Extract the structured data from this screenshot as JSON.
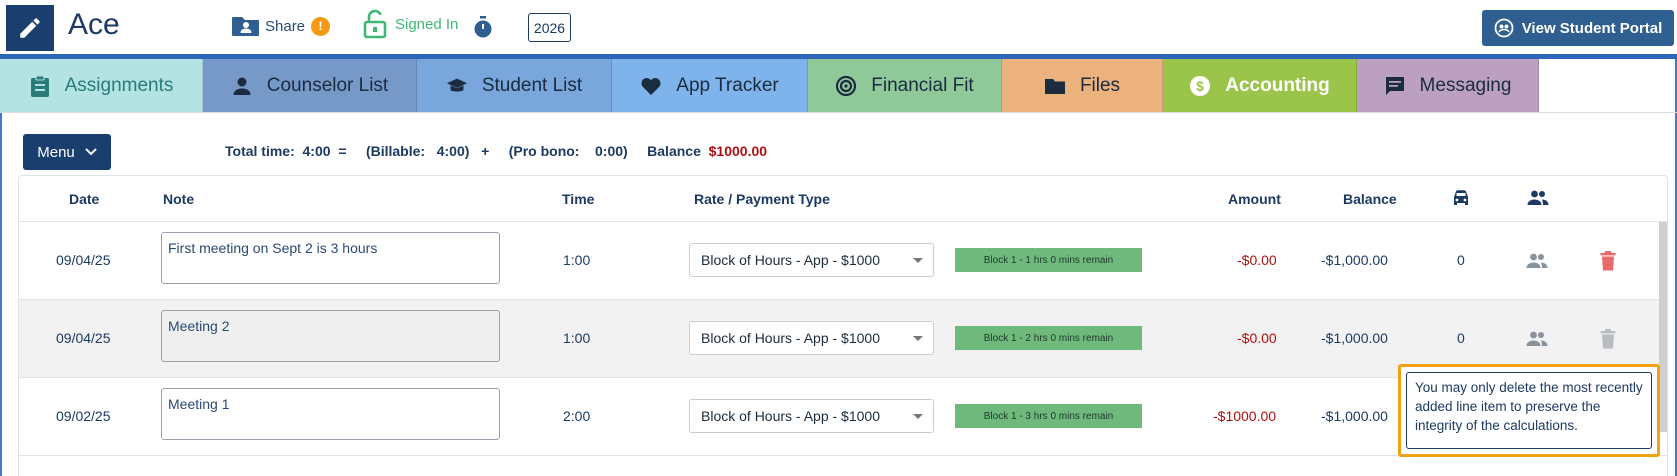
{
  "header": {
    "app_name": "Ace",
    "share_label": "Share",
    "share_badge": "!",
    "signed_in_label": "Signed In",
    "year": "2026",
    "portal_button": "View Student Portal"
  },
  "tabs": [
    {
      "label": "Assignments",
      "icon": "clipboard-icon",
      "bg": "#b3e3e3",
      "color": "#2a7a7a"
    },
    {
      "label": "Counselor List",
      "icon": "person-icon",
      "bg": "#7699c8"
    },
    {
      "label": "Student List",
      "icon": "graduation-cap-icon",
      "bg": "#79a6db"
    },
    {
      "label": "App Tracker",
      "icon": "heart-icon",
      "bg": "#7eb3eb"
    },
    {
      "label": "Financial Fit",
      "icon": "target-icon",
      "bg": "#8fc99a"
    },
    {
      "label": "Files",
      "icon": "folder-icon",
      "bg": "#ebb27e"
    },
    {
      "label": "Accounting",
      "icon": "dollar-icon",
      "bg": "#9bc44a",
      "color": "#ffffff"
    },
    {
      "label": "Messaging",
      "icon": "chat-icon",
      "bg": "#bca0c0"
    }
  ],
  "toolbar": {
    "menu_label": "Menu",
    "totals_text": "Total time:  4:00  =     (Billable:   4:00)   +     (Pro bono:    0:00)     Balance  ",
    "balance_value": "$1000.00"
  },
  "table": {
    "columns": {
      "date": "Date",
      "note": "Note",
      "time": "Time",
      "rate": "Rate / Payment Type",
      "amount": "Amount",
      "balance": "Balance"
    },
    "rows": [
      {
        "date": "09/04/25",
        "note": "First meeting on Sept 2 is 3 hours",
        "time": "1:00",
        "rate": "Block of Hours - App - $1000",
        "block": "Block 1 - 1 hrs 0 mins remain",
        "amount": "-$0.00",
        "balance": "-$1,000.00",
        "mileage": "0"
      },
      {
        "date": "09/04/25",
        "note": "Meeting 2",
        "time": "1:00",
        "rate": "Block of Hours - App - $1000",
        "block": "Block 1 - 2 hrs 0 mins remain",
        "amount": "-$0.00",
        "balance": "-$1,000.00",
        "mileage": "0"
      },
      {
        "date": "09/02/25",
        "note": "Meeting 1",
        "time": "2:00",
        "rate": "Block of Hours - App - $1000",
        "block": "Block 1 - 3 hrs 0 mins remain",
        "amount": "-$1000.00",
        "balance": "-$1,000.00",
        "mileage": ""
      }
    ]
  },
  "tooltip": {
    "text": "You may only delete the most recently added line item to preserve the integrity of the calculations."
  },
  "colors": {
    "primary": "#1a3e6e",
    "negative": "#b01010",
    "block_bg": "#6fb97c",
    "tooltip_border": "#f0a30f",
    "delete_active": "#e86a6a"
  }
}
